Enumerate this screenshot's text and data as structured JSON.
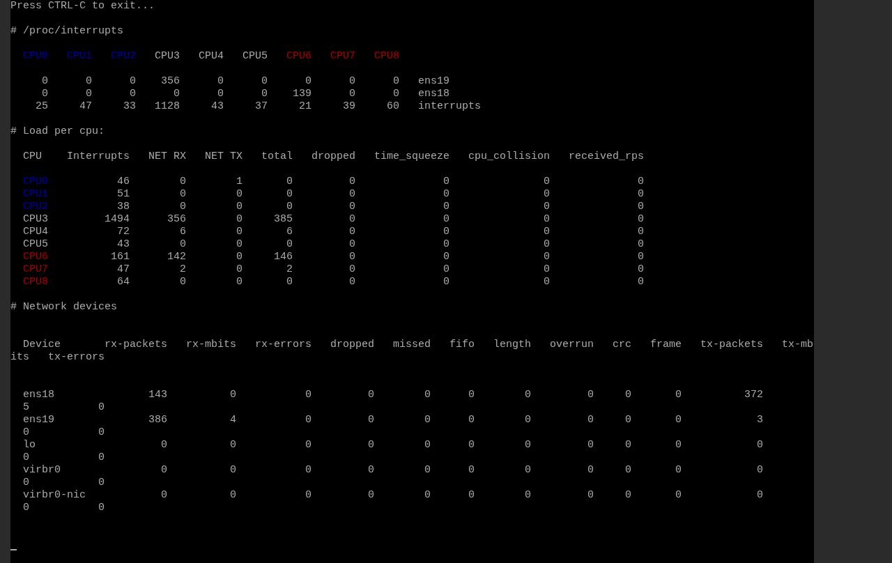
{
  "hint": "Press CTRL-C to exit...",
  "interrupts": {
    "title": "# /proc/interrupts",
    "cpus": [
      {
        "label": "CPU0",
        "color": "#0000aa"
      },
      {
        "label": "CPU1",
        "color": "#0000aa"
      },
      {
        "label": "CPU2",
        "color": "#0000aa"
      },
      {
        "label": "CPU3",
        "color": "#aaaaaa"
      },
      {
        "label": "CPU4",
        "color": "#aaaaaa"
      },
      {
        "label": "CPU5",
        "color": "#aaaaaa"
      },
      {
        "label": "CPU6",
        "color": "#aa0000"
      },
      {
        "label": "CPU7",
        "color": "#aa0000"
      },
      {
        "label": "CPU8",
        "color": "#aa0000"
      }
    ],
    "rows": [
      {
        "values": [
          "0",
          "0",
          "0",
          "356",
          "0",
          "0",
          "0",
          "0",
          "0"
        ],
        "name": "ens19"
      },
      {
        "values": [
          "0",
          "0",
          "0",
          "0",
          "0",
          "0",
          "139",
          "0",
          "0"
        ],
        "name": "ens18"
      },
      {
        "values": [
          "25",
          "47",
          "33",
          "1128",
          "43",
          "37",
          "21",
          "39",
          "60"
        ],
        "name": "interrupts"
      }
    ]
  },
  "load": {
    "title": "# Load per cpu:",
    "columns": [
      "CPU",
      "Interrupts",
      "NET RX",
      "NET TX",
      "total",
      "dropped",
      "time_squeeze",
      "cpu_collision",
      "received_rps"
    ],
    "rows": [
      {
        "cpu": "CPU0",
        "color": "#0000aa",
        "values": [
          "46",
          "0",
          "1",
          "0",
          "0",
          "0",
          "0",
          "0"
        ]
      },
      {
        "cpu": "CPU1",
        "color": "#0000aa",
        "values": [
          "51",
          "0",
          "0",
          "0",
          "0",
          "0",
          "0",
          "0"
        ]
      },
      {
        "cpu": "CPU2",
        "color": "#0000aa",
        "values": [
          "38",
          "0",
          "0",
          "0",
          "0",
          "0",
          "0",
          "0"
        ]
      },
      {
        "cpu": "CPU3",
        "color": "#aaaaaa",
        "values": [
          "1494",
          "356",
          "0",
          "385",
          "0",
          "0",
          "0",
          "0"
        ]
      },
      {
        "cpu": "CPU4",
        "color": "#aaaaaa",
        "values": [
          "72",
          "6",
          "0",
          "6",
          "0",
          "0",
          "0",
          "0"
        ]
      },
      {
        "cpu": "CPU5",
        "color": "#aaaaaa",
        "values": [
          "43",
          "0",
          "0",
          "0",
          "0",
          "0",
          "0",
          "0"
        ]
      },
      {
        "cpu": "CPU6",
        "color": "#aa0000",
        "values": [
          "161",
          "142",
          "0",
          "146",
          "0",
          "0",
          "0",
          "0"
        ]
      },
      {
        "cpu": "CPU7",
        "color": "#aa0000",
        "values": [
          "47",
          "2",
          "0",
          "2",
          "0",
          "0",
          "0",
          "0"
        ]
      },
      {
        "cpu": "CPU8",
        "color": "#aa0000",
        "values": [
          "64",
          "0",
          "0",
          "0",
          "0",
          "0",
          "0",
          "0"
        ]
      }
    ]
  },
  "network": {
    "title": "# Network devices",
    "columns": [
      "Device",
      "rx-packets",
      "rx-mbits",
      "rx-errors",
      "dropped",
      "missed",
      "fifo",
      "length",
      "overrun",
      "crc",
      "frame",
      "tx-packets",
      "tx-mb"
    ],
    "columns_wrapped": [
      "its",
      "tx-errors"
    ],
    "rows": [
      {
        "device": "ens18",
        "values": [
          "143",
          "0",
          "0",
          "0",
          "0",
          "0",
          "0",
          "0",
          "0",
          "0",
          "372"
        ],
        "wrapped": [
          "5",
          "0"
        ]
      },
      {
        "device": "ens19",
        "values": [
          "386",
          "4",
          "0",
          "0",
          "0",
          "0",
          "0",
          "0",
          "0",
          "0",
          "3"
        ],
        "wrapped": [
          "0",
          "0"
        ]
      },
      {
        "device": "lo",
        "values": [
          "0",
          "0",
          "0",
          "0",
          "0",
          "0",
          "0",
          "0",
          "0",
          "0",
          "0"
        ],
        "wrapped": [
          "0",
          "0"
        ]
      },
      {
        "device": "virbr0",
        "values": [
          "0",
          "0",
          "0",
          "0",
          "0",
          "0",
          "0",
          "0",
          "0",
          "0",
          "0"
        ],
        "wrapped": [
          "0",
          "0"
        ]
      },
      {
        "device": "virbr0-nic",
        "values": [
          "0",
          "0",
          "0",
          "0",
          "0",
          "0",
          "0",
          "0",
          "0",
          "0",
          "0"
        ],
        "wrapped": [
          "0",
          "0"
        ]
      }
    ]
  }
}
